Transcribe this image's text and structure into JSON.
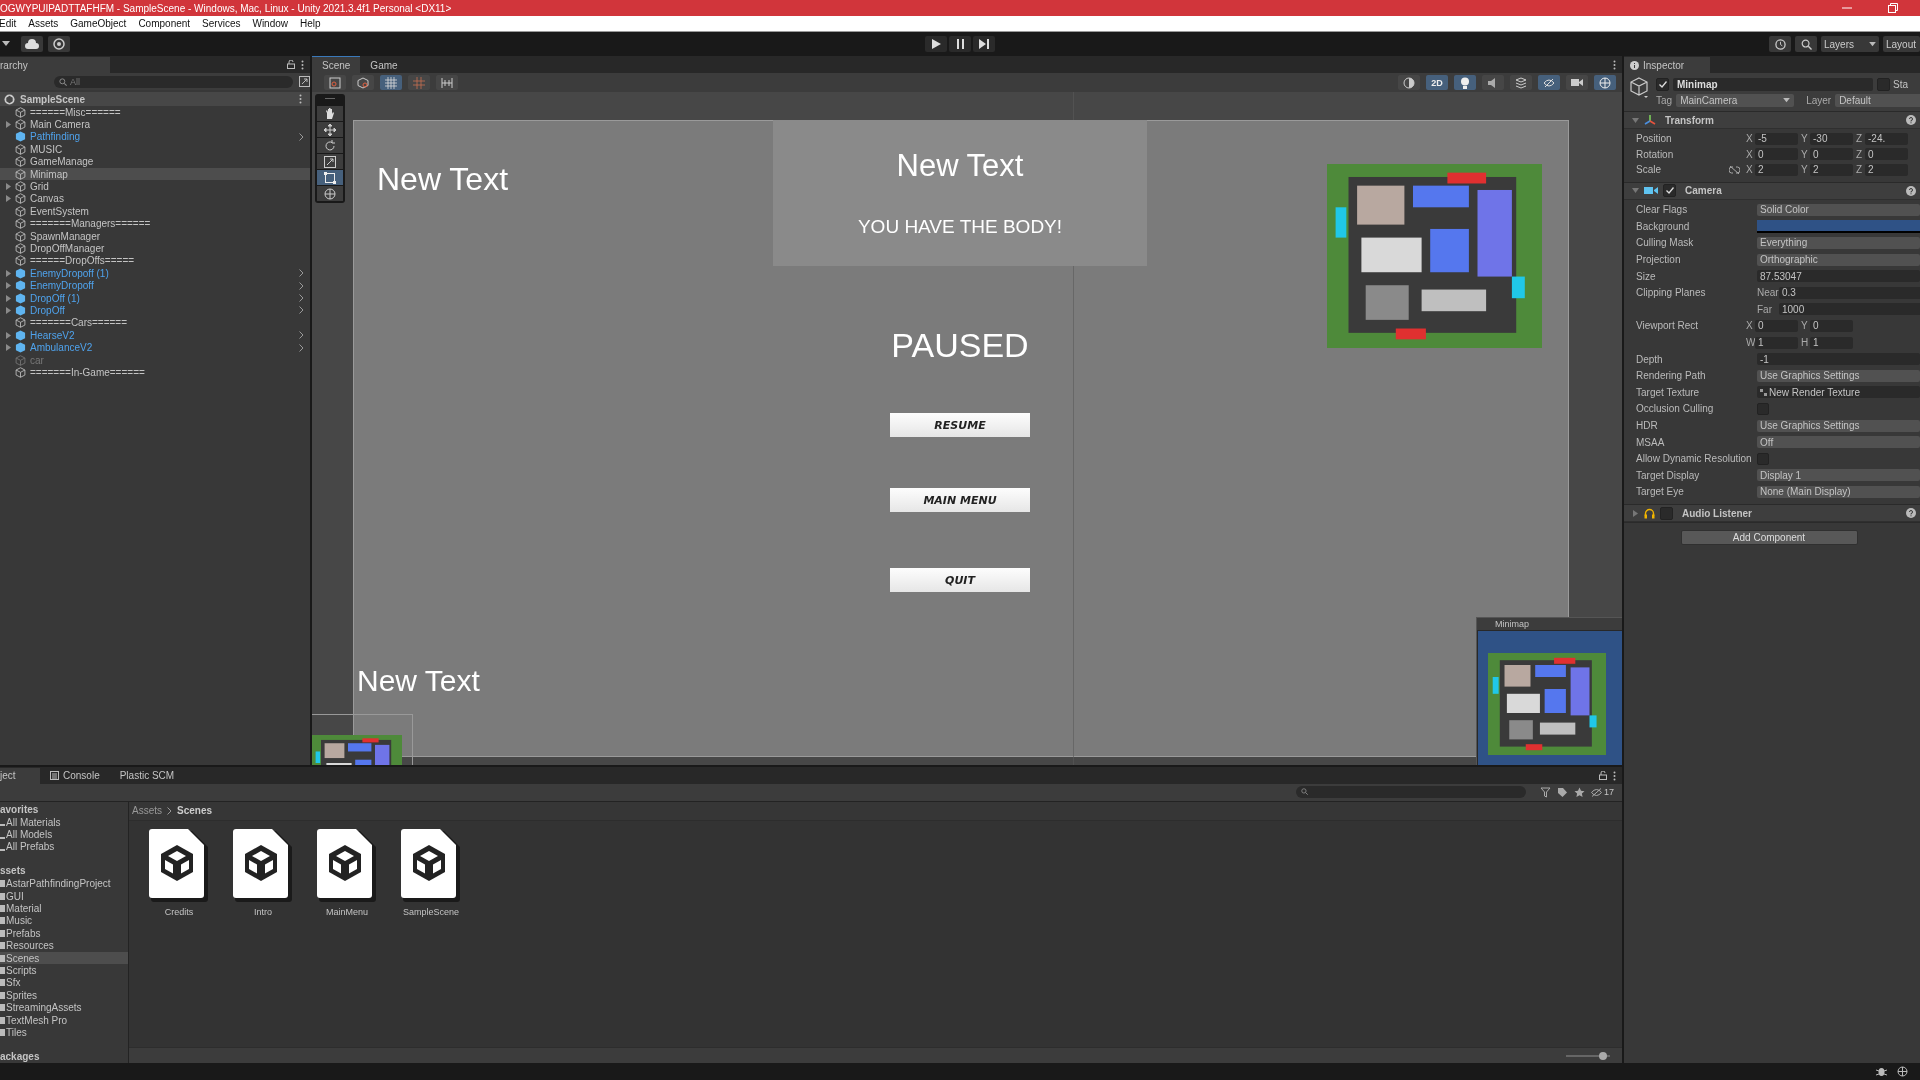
{
  "window": {
    "title": "OGWYPUIPADTTAFHFM - SampleScene - Windows, Mac, Linux - Unity 2021.3.4f1 Personal <DX11>"
  },
  "menu": [
    "Edit",
    "Assets",
    "GameObject",
    "Component",
    "Services",
    "Window",
    "Help"
  ],
  "toolbar": {
    "layers": "Layers",
    "layout": "Layout"
  },
  "hierarchy": {
    "title": "rarchy",
    "search": {
      "placeholder": "All"
    },
    "scene": "SampleScene",
    "items": [
      {
        "label": "======Misc======",
        "prefab": false,
        "expandable": false,
        "selected": false,
        "disabled": false
      },
      {
        "label": "Main Camera",
        "prefab": false,
        "expandable": true,
        "selected": false,
        "disabled": false
      },
      {
        "label": "Pathfinding",
        "prefab": true,
        "expandable": false,
        "selected": false,
        "disabled": false
      },
      {
        "label": "MUSIC",
        "prefab": false,
        "expandable": false,
        "selected": false,
        "disabled": false
      },
      {
        "label": "GameManage",
        "prefab": false,
        "expandable": false,
        "selected": false,
        "disabled": false
      },
      {
        "label": "Minimap",
        "prefab": false,
        "expandable": false,
        "selected": true,
        "disabled": false
      },
      {
        "label": "Grid",
        "prefab": false,
        "expandable": true,
        "selected": false,
        "disabled": false
      },
      {
        "label": "Canvas",
        "prefab": false,
        "expandable": true,
        "selected": false,
        "disabled": false
      },
      {
        "label": "EventSystem",
        "prefab": false,
        "expandable": false,
        "selected": false,
        "disabled": false
      },
      {
        "label": "=======Managers======",
        "prefab": false,
        "expandable": false,
        "selected": false,
        "disabled": false
      },
      {
        "label": "SpawnManager",
        "prefab": false,
        "expandable": false,
        "selected": false,
        "disabled": false
      },
      {
        "label": "DropOffManager",
        "prefab": false,
        "expandable": false,
        "selected": false,
        "disabled": false
      },
      {
        "label": "======DropOffs=====",
        "prefab": false,
        "expandable": false,
        "selected": false,
        "disabled": false
      },
      {
        "label": "EnemyDropoff (1)",
        "prefab": true,
        "expandable": true,
        "selected": false,
        "disabled": false
      },
      {
        "label": "EnemyDropoff",
        "prefab": true,
        "expandable": true,
        "selected": false,
        "disabled": false
      },
      {
        "label": "DropOff (1)",
        "prefab": true,
        "expandable": true,
        "selected": false,
        "disabled": false
      },
      {
        "label": "DropOff",
        "prefab": true,
        "expandable": true,
        "selected": false,
        "disabled": false
      },
      {
        "label": "=======Cars======",
        "prefab": false,
        "expandable": false,
        "selected": false,
        "disabled": false
      },
      {
        "label": "HearseV2",
        "prefab": true,
        "expandable": true,
        "selected": false,
        "disabled": false
      },
      {
        "label": "AmbulanceV2",
        "prefab": true,
        "expandable": true,
        "selected": false,
        "disabled": false
      },
      {
        "label": "car",
        "prefab": false,
        "expandable": false,
        "selected": false,
        "disabled": true
      },
      {
        "label": "=======In-Game======",
        "prefab": false,
        "expandable": false,
        "selected": false,
        "disabled": false
      }
    ]
  },
  "scene": {
    "tabs": [
      {
        "label": "Scene",
        "selected": true
      },
      {
        "label": "Game",
        "selected": false
      }
    ],
    "toggle_2d": {
      "label": "2D",
      "on": true
    },
    "texts": {
      "top_left": "New Text",
      "panel_title": "New Text",
      "panel_message": "YOU HAVE THE BODY!",
      "paused": "PAUSED",
      "bottom_left": "New Text"
    },
    "buttons": [
      "RESUME",
      "MAIN MENU",
      "QUIT"
    ],
    "minimap_window": {
      "title": "Minimap"
    }
  },
  "inspector": {
    "title": "Inspector",
    "object": {
      "name": "Minimap",
      "active": true,
      "static": false,
      "static_label": "Sta",
      "tag_label": "Tag",
      "tag": "MainCamera",
      "layer_label": "Layer",
      "layer": "Default"
    },
    "components": [
      {
        "kind": "transform",
        "name": "Transform",
        "expanded": true,
        "rows": [
          {
            "kind": "xyz",
            "label": "Position",
            "linked": false,
            "parts": [
              {
                "prefix": "X",
                "value": "-5"
              },
              {
                "prefix": "Y",
                "value": "-30"
              },
              {
                "prefix": "Z",
                "value": "-24."
              }
            ]
          },
          {
            "kind": "xyz",
            "label": "Rotation",
            "linked": false,
            "parts": [
              {
                "prefix": "X",
                "value": "0"
              },
              {
                "prefix": "Y",
                "value": "0"
              },
              {
                "prefix": "Z",
                "value": "0"
              }
            ]
          },
          {
            "kind": "xyz",
            "label": "Scale",
            "linked": true,
            "parts": [
              {
                "prefix": "X",
                "value": "2"
              },
              {
                "prefix": "Y",
                "value": "2"
              },
              {
                "prefix": "Z",
                "value": "2"
              }
            ]
          }
        ]
      },
      {
        "kind": "camera",
        "name": "Camera",
        "expanded": true,
        "enabled": true,
        "rows": [
          {
            "kind": "dropdown",
            "label": "Clear Flags",
            "value": "Solid Color"
          },
          {
            "kind": "color",
            "label": "Background",
            "color": "#2f5286"
          },
          {
            "kind": "dropdown",
            "label": "Culling Mask",
            "value": "Everything"
          },
          {
            "kind": "dropdown",
            "label": "Projection",
            "value": "Orthographic"
          },
          {
            "kind": "field",
            "label": "Size",
            "value": "87.53047"
          },
          {
            "kind": "wide",
            "label": "Clipping Planes",
            "parts": [
              {
                "prefix": "Near",
                "value": "0.3"
              }
            ]
          },
          {
            "kind": "wide",
            "parts": [
              {
                "prefix": "Far",
                "value": "1000"
              }
            ]
          },
          {
            "kind": "xyz",
            "label": "Viewport Rect",
            "linked": false,
            "parts": [
              {
                "prefix": "X",
                "value": "0"
              },
              {
                "prefix": "Y",
                "value": "0"
              }
            ]
          },
          {
            "kind": "xyz",
            "linked": false,
            "parts": [
              {
                "prefix": "W",
                "value": "1"
              },
              {
                "prefix": "H",
                "value": "1"
              }
            ]
          },
          {
            "kind": "field",
            "label": "Depth",
            "value": "-1"
          },
          {
            "kind": "dropdown",
            "label": "Rendering Path",
            "value": "Use Graphics Settings"
          },
          {
            "kind": "object",
            "label": "Target Texture",
            "value": "New Render Texture"
          },
          {
            "kind": "checkbox",
            "label": "Occlusion Culling",
            "checked": false
          },
          {
            "kind": "dropdown",
            "label": "HDR",
            "value": "Use Graphics Settings"
          },
          {
            "kind": "dropdown",
            "label": "MSAA",
            "value": "Off"
          },
          {
            "kind": "checkbox",
            "label": "Allow Dynamic Resolution",
            "checked": false
          },
          {
            "kind": "dropdown",
            "label": "Target Display",
            "value": "Display 1"
          },
          {
            "kind": "dropdown",
            "label": "Target Eye",
            "value": "None (Main Display)"
          }
        ]
      },
      {
        "kind": "audio",
        "name": "Audio Listener",
        "expanded": false,
        "enabled": false
      }
    ],
    "add_button": "Add Component"
  },
  "project": {
    "tabs": [
      {
        "label": "ject",
        "selected": true
      },
      {
        "label": "Console",
        "selected": false
      },
      {
        "label": "Plastic SCM",
        "selected": false
      }
    ],
    "hidden_count": "17",
    "tree": [
      {
        "label": "avorites",
        "children": [
          {
            "label": "All Materials",
            "selected": false
          },
          {
            "label": "All Models",
            "selected": false
          },
          {
            "label": "All Prefabs",
            "selected": false
          }
        ]
      },
      {
        "label": "ssets",
        "children": [
          {
            "label": "AstarPathfindingProject",
            "selected": false
          },
          {
            "label": "GUI",
            "selected": false
          },
          {
            "label": "Material",
            "selected": false
          },
          {
            "label": "Music",
            "selected": false
          },
          {
            "label": "Prefabs",
            "selected": false
          },
          {
            "label": "Resources",
            "selected": false
          },
          {
            "label": "Scenes",
            "selected": true
          },
          {
            "label": "Scripts",
            "selected": false
          },
          {
            "label": "Sfx",
            "selected": false
          },
          {
            "label": "Sprites",
            "selected": false
          },
          {
            "label": "StreamingAssets",
            "selected": false
          },
          {
            "label": "TextMesh Pro",
            "selected": false
          },
          {
            "label": "Tiles",
            "selected": false
          }
        ]
      },
      {
        "label": "ackages"
      }
    ],
    "zoom": {
      "level": 0.85
    },
    "breadcrumb": [
      "Assets",
      "Scenes"
    ],
    "assets": [
      "Credits",
      "Intro",
      "MainMenu",
      "SampleScene"
    ]
  }
}
